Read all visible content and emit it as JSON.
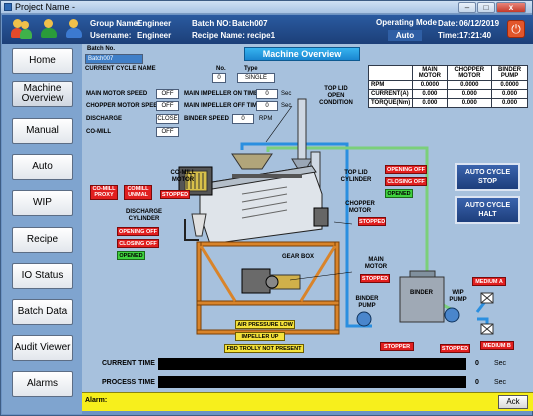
{
  "window": {
    "title": "Project Name -",
    "controls": {
      "minimize": "–",
      "maximize": "□",
      "close": "x"
    }
  },
  "header": {
    "group_name_label": "Group Name:",
    "group_name": "Engineer",
    "username_label": "Username:",
    "username": "Engineer",
    "batch_no_label": "Batch NO:",
    "batch_no": "Batch007",
    "recipe_name_label": "Recipe Name:",
    "recipe_name": "recipe1",
    "operating_mode_label": "Operating Mode",
    "operating_mode": "Auto",
    "date_label": "Date:",
    "date": "06/12/2019",
    "time_label": "Time:",
    "time": "17:21:40",
    "icons": [
      "users-icon",
      "user-check-icon",
      "user-swap-icon",
      "power-icon"
    ]
  },
  "sidebar": {
    "items": [
      {
        "label": "Home"
      },
      {
        "label": "Machine Overview"
      },
      {
        "label": "Manual"
      },
      {
        "label": "Auto"
      },
      {
        "label": "WIP"
      },
      {
        "label": "Recipe"
      },
      {
        "label": "IO Status"
      },
      {
        "label": "Batch Data"
      },
      {
        "label": "Audit Viewer"
      },
      {
        "label": "Alarms"
      }
    ]
  },
  "main": {
    "title": "Machine Overview",
    "batch_no_label": "Batch No.",
    "batch_no_value": "Batch007",
    "current_cycle_label": "CURRENT CYCLE NAME",
    "no_label": "No.",
    "no_value": "0",
    "type_label": "Type",
    "type_value": "SINGLE",
    "params": {
      "main_motor_speed_label": "MAIN MOTOR SPEED",
      "main_motor_speed": "OFF",
      "chopper_motor_speed_label": "CHOPPER MOTOR SPEED",
      "chopper_motor_speed": "OFF",
      "discharge_label": "DISCHARGE",
      "discharge": "CLOSE",
      "co_mill_label": "CO-MILL",
      "co_mill": "OFF",
      "impeller_on_label": "MAIN IMPELLER ON TIME",
      "impeller_on": "0",
      "impeller_off_label": "MAIN IMPELLER OFF TIME",
      "impeller_off": "0",
      "binder_speed_label": "BINDER SPEED",
      "binder_speed": "0",
      "sec_unit": "Sec",
      "rpm_unit": "RPM"
    },
    "table": {
      "headers": [
        "",
        "MAIN MOTOR",
        "CHOPPER MOTOR",
        "BINDER PUMP"
      ],
      "rows": [
        [
          "RPM",
          "0.0000",
          "0.0000",
          "0.0000"
        ],
        [
          "CURRENT(A)",
          "0.000",
          "0.000",
          "0.000"
        ],
        [
          "TORQUE(Nm)",
          "0.000",
          "0.000",
          "0.000"
        ]
      ]
    },
    "diagram": {
      "top_lid_open": "TOP LID OPEN CONDITION",
      "top_lid_cylinder": "TOP LID CYLINDER",
      "opening_off_1": "OPENING OFF",
      "closing_off_1": "CLOSING OFF",
      "opened_1": "OPENED",
      "chopper_motor": "CHOPPER MOTOR",
      "chopper_stopped": "STOPPED",
      "co_mill_motor": "CO-MILL MOTOR",
      "co_mill_proxy": "CO-MILL PROXY",
      "comill_unmal": "COMILL UNMAL",
      "co_mill_stopped": "STOPPED",
      "discharge_cylinder": "DISCHARGE CYLINDER",
      "opening_off_2": "OPENING OFF",
      "closing_off_2": "CLOSING OFF",
      "opened_2": "OPENED",
      "gear_box": "GEAR BOX",
      "main_motor": "MAIN MOTOR",
      "main_stopped": "STOPPED",
      "binder_pump": "BINDER PUMP",
      "binder": "BINDER",
      "binder_stopped": "STOPPER",
      "wip_pump": "WIP PUMP",
      "wip_stopped": "STOPPED",
      "medium_a": "MEDIUM A",
      "medium_b": "MEDIUM B",
      "air_pressure_low": "AIR PRESSURE LOW",
      "impeller_up": "IMPELLER UP",
      "fbd_trolly": "FBD TROLLY NOT PRESENT"
    },
    "auto_cycle_stop": "AUTO CYCLE STOP",
    "auto_cycle_halt": "AUTO CYCLE HALT",
    "current_time_label": "CURRENT TIME",
    "current_time_value": "0",
    "process_time_label": "PROCESS TIME",
    "process_time_value": "0",
    "time_unit": "Sec"
  },
  "alarm": {
    "label": "Alarm:",
    "ack_label": "Ack"
  },
  "colors": {
    "header_bg": "#1c3f78",
    "main_bg": "#a7c1dd",
    "alarm_bg": "#f7ef1c",
    "status_red": "#e11f1f",
    "status_green": "#3fd13f",
    "pipe_blue": "#2a8fe0",
    "pipe_green": "#7bd07b"
  }
}
